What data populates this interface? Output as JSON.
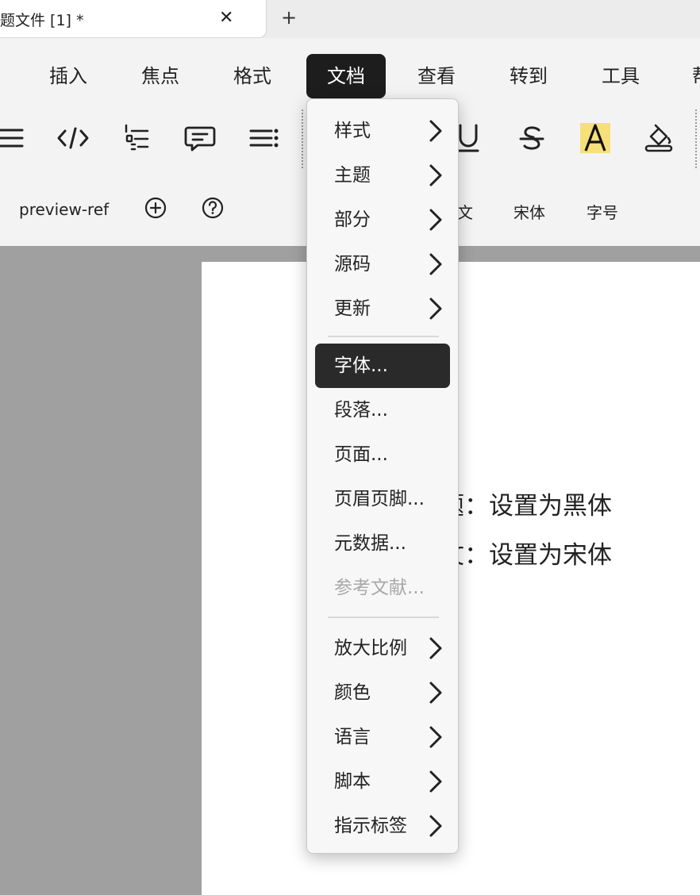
{
  "tab": {
    "title": "题文件 [1] *",
    "close_glyph": "✕",
    "add_glyph": "+"
  },
  "menubar": {
    "items": [
      "插入",
      "焦点",
      "格式",
      "文档",
      "查看",
      "转到",
      "工具",
      "帮"
    ],
    "active": "文档"
  },
  "toolbar": {
    "icons": [
      "list-icon",
      "code-icon",
      "numbered-list-icon",
      "comment-icon",
      "align-icon",
      "underline-icon",
      "strikethrough-icon",
      "highlight-icon",
      "fill-icon"
    ],
    "highlight_color": "#f6e07a"
  },
  "row2": {
    "preview_ref": "preview-ref",
    "partial_text": "文",
    "font_label": "宋体",
    "size_label": "字号"
  },
  "document": {
    "line1": "题：设置为黑体",
    "line2": "文：设置为宋体"
  },
  "dropdown": {
    "items": [
      {
        "label": "样式",
        "submenu": true
      },
      {
        "label": "主题",
        "submenu": true
      },
      {
        "label": "部分",
        "submenu": true
      },
      {
        "label": "源码",
        "submenu": true
      },
      {
        "label": "更新",
        "submenu": true
      },
      {
        "label": "字体...",
        "submenu": false,
        "highlighted": true
      },
      {
        "label": "段落...",
        "submenu": false
      },
      {
        "label": "页面...",
        "submenu": false
      },
      {
        "label": "页眉页脚...",
        "submenu": false
      },
      {
        "label": "元数据...",
        "submenu": false
      },
      {
        "label": "参考文献...",
        "submenu": false,
        "disabled": true
      },
      {
        "label": "放大比例",
        "submenu": true
      },
      {
        "label": "颜色",
        "submenu": true
      },
      {
        "label": "语言",
        "submenu": true
      },
      {
        "label": "脚本",
        "submenu": true
      },
      {
        "label": "指示标签",
        "submenu": true
      }
    ]
  },
  "colors": {
    "active_menu_bg": "#1d1d1d",
    "highlight_item_bg": "#2a2a2a",
    "doc_background": "#a0a0a0",
    "disabled_text": "#a8a8a8"
  }
}
